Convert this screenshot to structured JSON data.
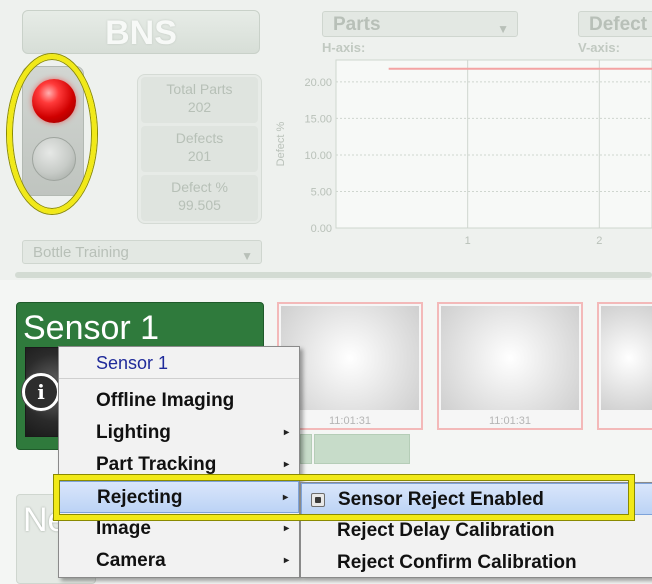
{
  "top_panel": {
    "title": "BNS",
    "stats": [
      {
        "label": "Total Parts",
        "value": "202"
      },
      {
        "label": "Defects",
        "value": "201"
      },
      {
        "label": "Defect %",
        "value": "99.505"
      }
    ],
    "training_dropdown": "Bottle Training",
    "h_axis_dropdown": "Parts",
    "h_axis_caption": "H-axis:",
    "v_axis_dropdown": "Defect",
    "v_axis_caption": "V-axis:",
    "status_light": {
      "red": "on",
      "second": "off"
    }
  },
  "chart_data": {
    "type": "line",
    "ylabel": "Defect %",
    "yticks": [
      "0.00",
      "5.00",
      "10.00",
      "15.00",
      "20.00"
    ],
    "xticks": [
      "1",
      "2"
    ],
    "ylim": [
      0,
      23
    ],
    "series": [
      {
        "x": [
          0.4,
          2.4
        ],
        "values": [
          21.8,
          21.8
        ]
      }
    ],
    "colors": {
      "series": "#f4a3a3",
      "grid": "#cfd6cf"
    }
  },
  "sensor_panel": {
    "title": "Sensor 1",
    "second_title": "Ne",
    "info_icon": "i",
    "images": [
      {
        "time": "11:01:31"
      },
      {
        "time": "11:01:31"
      },
      {
        "time": ""
      }
    ]
  },
  "context_menu": {
    "header": "Sensor 1",
    "items": [
      {
        "label": "Offline Imaging",
        "has_submenu": false
      },
      {
        "label": "Lighting",
        "has_submenu": true
      },
      {
        "label": "Part Tracking",
        "has_submenu": true
      },
      {
        "label": "Rejecting",
        "has_submenu": true
      },
      {
        "label": "Image",
        "has_submenu": true
      },
      {
        "label": "Camera",
        "has_submenu": true
      }
    ],
    "submenu_arrow": "▸",
    "submenu": [
      {
        "label": "Sensor Reject Enabled",
        "checked": true
      },
      {
        "label": "Reject Delay Calibration"
      },
      {
        "label": "Reject Confirm Calibration"
      }
    ]
  },
  "colors": {
    "highlight": "#f1e918",
    "sensor_header": "#2f7a3c"
  }
}
